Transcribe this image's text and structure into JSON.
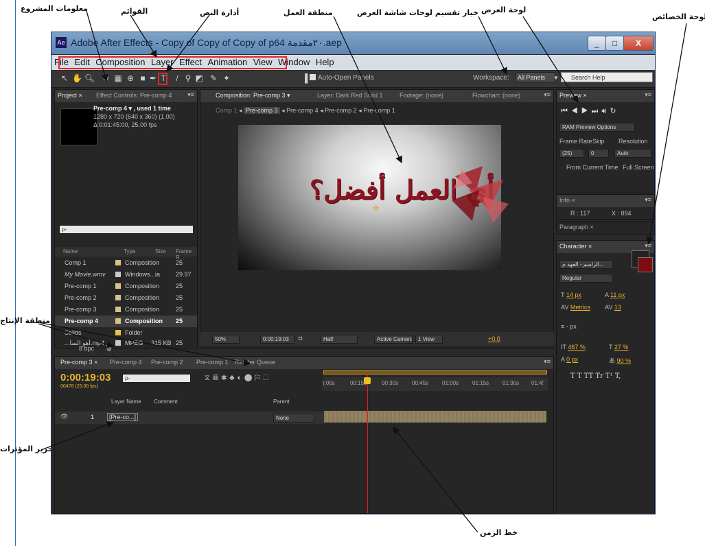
{
  "annotations": {
    "project_info": "معلومات المشروع",
    "menus": "القوائم",
    "text_tool": "أدارة النص",
    "work_area": "منطقة العمل",
    "workspace_option": "خيار تقسيم لوحات شاشة العرض",
    "preview_panel": "لوحة العرض",
    "properties_panel": "لوحة الخصائص",
    "render_area": "منطقة الإنتاج",
    "effects_editing": "تحرير المؤثرات",
    "timeline": "خط الزمن"
  },
  "window": {
    "app_icon": "Ae",
    "title": "Adobe After Effects - Copy of Copy of Copy of p64 ٢٠مقدمة.aep",
    "min": "_",
    "max": "□",
    "close": "X"
  },
  "menu": [
    "File",
    "Edit",
    "Composition",
    "Layer",
    "Effect",
    "Animation",
    "View",
    "Window",
    "Help"
  ],
  "toolbar": {
    "auto_open": "Auto-Open Panels",
    "workspace_label": "Workspace:",
    "workspace_value": "All Panels",
    "search_placeholder": "Search Help"
  },
  "project_panel": {
    "tab_project": "Project ×",
    "tab_effect": "Effect Controls: Pre-comp 4",
    "info_name": "Pre-comp 4 ▾ , used 1 time",
    "info_size": "1280 x 720  (640 x 360) (1.00)",
    "info_duration": "Δ 0:01:45:00, 25.00 fps",
    "search": "ρ-",
    "col_name": "Name",
    "col_type": "Type",
    "col_size": "Size",
    "col_rate": "Frame R...",
    "items": [
      {
        "name": "Comp 1",
        "type": "Composition",
        "size": "",
        "rate": "25"
      },
      {
        "name": "My Movie.wmv",
        "type": "Windows...ia",
        "size": "",
        "rate": "29.97"
      },
      {
        "name": "Pre-comp 1",
        "type": "Composition",
        "size": "",
        "rate": "25"
      },
      {
        "name": "Pre-comp 2",
        "type": "Composition",
        "size": "",
        "rate": "25"
      },
      {
        "name": "Pre-comp 3",
        "type": "Composition",
        "size": "",
        "rate": "25"
      },
      {
        "name": "Pre-comp 4",
        "type": "Composition",
        "size": "",
        "rate": "25"
      },
      {
        "name": "Solids",
        "type": "Folder",
        "size": "",
        "rate": ""
      },
      {
        "name": "...أهو السا.mp4",
        "type": "MPEG",
        "size": "315 KB",
        "rate": "25"
      }
    ],
    "bpc": "8 bpc"
  },
  "comp_panel": {
    "tab_comp": "Composition: Pre-comp 3 ▾",
    "tab_layer": "Layer: Dark Red Solid 1",
    "tab_footage": "Footage: (none)",
    "tab_flowchart": "Flowchart: (none)",
    "breadcrumbs": [
      "Comp 1",
      "Pre-comp 3",
      "Pre-comp 4",
      "Pre-comp 2",
      "Pre-comp 1"
    ],
    "art_text": "أي العمل أفضل؟",
    "zoom": "50%",
    "timecode": "0:00:19:03",
    "resolution": "Half",
    "camera": "Active Camera",
    "views": "1 View",
    "offset": "+0.0"
  },
  "preview_panel": {
    "tab": "Preview ×",
    "ram_options": "RAM Preview Options",
    "frame_rate_label": "Frame Rate",
    "skip_label": "Skip",
    "resolution_label": "Resolution",
    "frame_rate": "(25)",
    "skip": "0",
    "resolution": "Auto",
    "from_current": "From Current Time",
    "full_screen": "Full Screen"
  },
  "info_panel": {
    "tab": "Info ×",
    "r": "R : 117",
    "x": "X : 894"
  },
  "paragraph_panel": {
    "tab": "Paragraph ×"
  },
  "character_panel": {
    "tab": "Character ×",
    "font": "الراسم - العهد م...",
    "style": "Regular",
    "font_size": "14 px",
    "leading": "11 px",
    "kerning": "Metrics",
    "tracking": "13",
    "stroke": "- px",
    "vscale": "467 %",
    "hscale": "27 %",
    "baseline": "0 px",
    "tsume": "90 %",
    "styles": "T  T  TT  Tr  T¹  T,"
  },
  "timeline": {
    "tabs": [
      "Pre-comp 3 ×",
      "Pre-comp 4",
      "Pre-comp 2",
      "Pre-comp 1",
      "Render Queue"
    ],
    "timecode": "0:00:19:03",
    "frames": "00478 (25.00 fps)",
    "search": "ρ-",
    "col_layer": "Layer Name",
    "col_comment": "Comment",
    "col_parent": "Parent",
    "ticks": [
      "):00s",
      "00:15s",
      "00:30s",
      "00:45s",
      "01:00s",
      "01:15s",
      "01:30s",
      "01:4!"
    ],
    "layer_num": "1",
    "layer_name": "[Pre-co...]",
    "parent": "None"
  }
}
